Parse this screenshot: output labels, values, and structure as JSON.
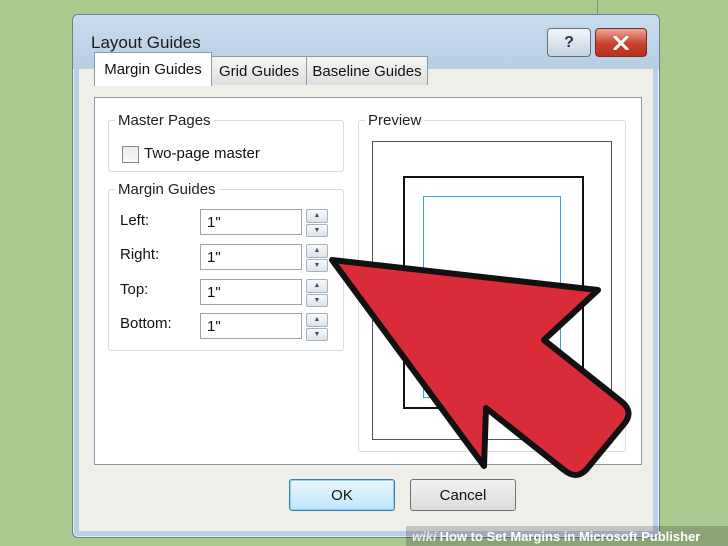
{
  "window": {
    "title": "Layout Guides",
    "help_symbol": "?",
    "close_icon": "close-x-icon"
  },
  "tabs": [
    {
      "label": "Margin Guides",
      "active": true
    },
    {
      "label": "Grid Guides",
      "active": false
    },
    {
      "label": "Baseline Guides",
      "active": false
    }
  ],
  "master_pages": {
    "legend": "Master Pages",
    "two_page_label": "Two-page master",
    "two_page_checked": false
  },
  "margin_guides": {
    "legend": "Margin Guides",
    "fields": [
      {
        "label": "Left:",
        "value": "1\""
      },
      {
        "label": "Right:",
        "value": "1\""
      },
      {
        "label": "Top:",
        "value": "1\""
      },
      {
        "label": "Bottom:",
        "value": "1\""
      }
    ]
  },
  "preview": {
    "legend": "Preview",
    "guide_color": "#3aa2d8"
  },
  "buttons": {
    "ok": "OK",
    "cancel": "Cancel"
  },
  "overlay": {
    "arrow_color": "#d92b38",
    "watermark_wiki": "wiki",
    "watermark_text": "How to Set Margins in Microsoft Publisher"
  }
}
